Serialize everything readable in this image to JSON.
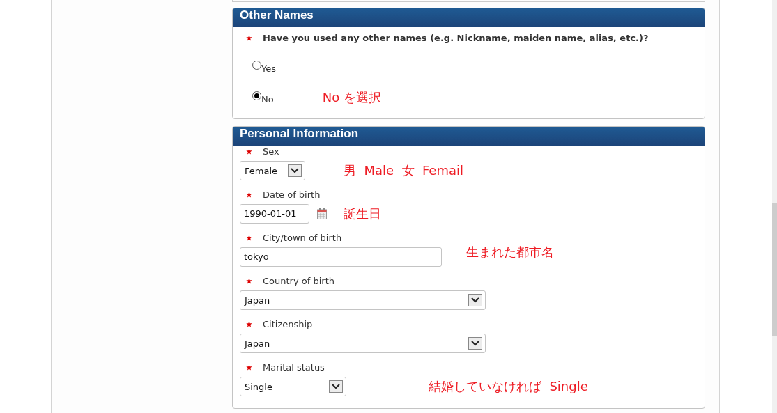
{
  "other_names": {
    "title": "Other Names",
    "question": "Have you used any other names (e.g. Nickname, maiden name, alias, etc.)?",
    "options": [
      {
        "label": "Yes",
        "selected": false
      },
      {
        "label": "No",
        "selected": true,
        "annotation": "No を選択"
      }
    ]
  },
  "personal_information": {
    "title": "Personal Information",
    "fields": [
      {
        "kind": "select",
        "label": "Sex",
        "value": "Female",
        "annotation": "男  Male  女  Femail"
      },
      {
        "kind": "date",
        "label": "Date of birth",
        "value": "1990-01-01",
        "annotation": "誕生日"
      },
      {
        "kind": "text",
        "label": "City/town of birth",
        "value": "tokyo",
        "annotation": "生まれた都市名"
      },
      {
        "kind": "select",
        "label": "Country of birth",
        "value": "Japan"
      },
      {
        "kind": "select",
        "label": "Citizenship",
        "value": "Japan"
      },
      {
        "kind": "select",
        "label": "Marital status",
        "value": "Single",
        "annotation": "結婚していなければ  Single"
      }
    ]
  }
}
